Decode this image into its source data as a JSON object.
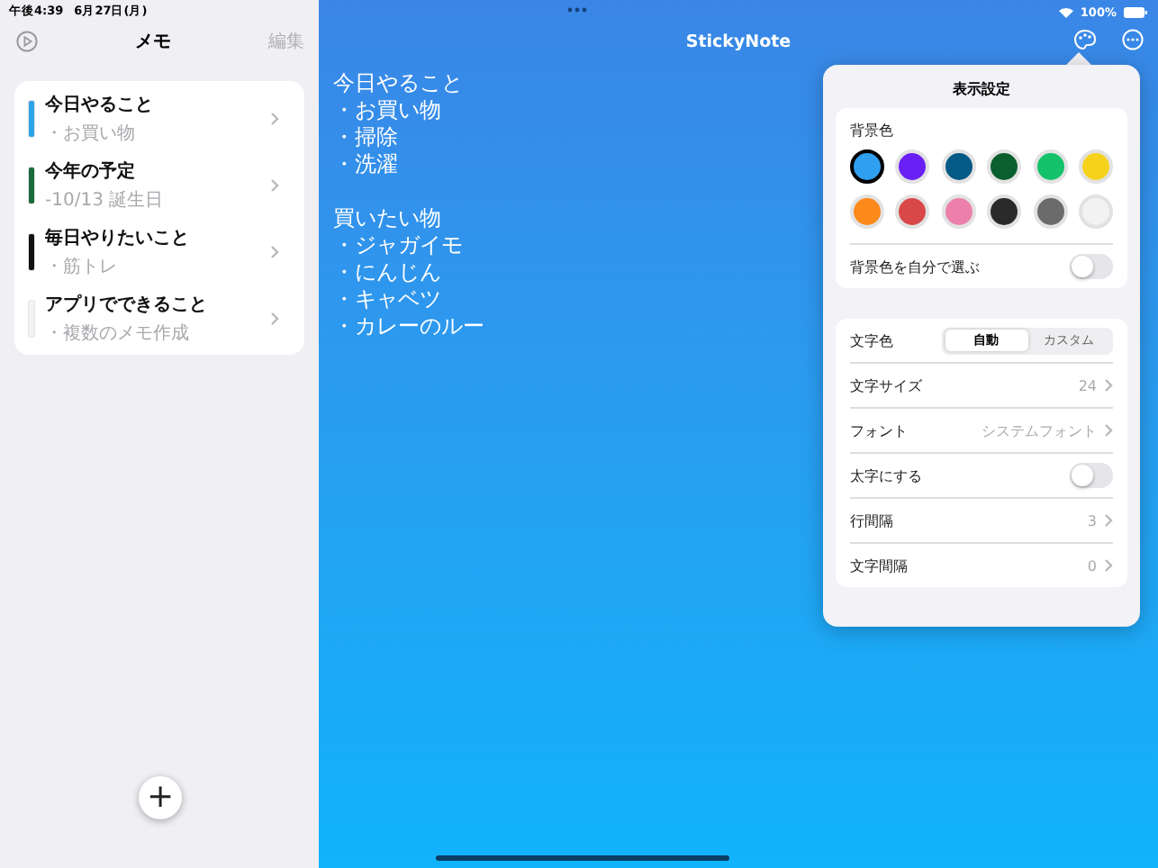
{
  "status_bar": {
    "time": "午後4:39",
    "date": "6月27日(月)",
    "battery": "100%"
  },
  "sidebar": {
    "title": "メモ",
    "edit": "編集",
    "memos": [
      {
        "title": "今日やること",
        "subtitle": "・お買い物",
        "color": "#2ea3e8"
      },
      {
        "title": "今年の予定",
        "subtitle": "-10/13 誕生日",
        "color": "#1a6b3c"
      },
      {
        "title": "毎日やりたいこと",
        "subtitle": "・筋トレ",
        "color": "#111111"
      },
      {
        "title": "アプリでできること",
        "subtitle": "・複数のメモ作成",
        "color": "#f2f2f2"
      }
    ],
    "add": "+"
  },
  "note": {
    "title": "StickyNote",
    "paragraphs": [
      {
        "lines": [
          "今日やること",
          "・お買い物",
          "・掃除",
          "・洗濯"
        ]
      },
      {
        "lines": [
          "買いたい物",
          "・ジャガイモ",
          "・にんじん",
          "・キャベツ",
          "・カレーのルー"
        ]
      }
    ]
  },
  "settings": {
    "title": "表示設定",
    "background_label": "背景色",
    "swatches": [
      {
        "color": "#2f9ff0",
        "selected": true
      },
      {
        "color": "#6a1ff5",
        "selected": false
      },
      {
        "color": "#045a86",
        "selected": false
      },
      {
        "color": "#0b5f2e",
        "selected": false
      },
      {
        "color": "#13c26a",
        "selected": false
      },
      {
        "color": "#f7d21d",
        "selected": false
      },
      {
        "color": "#fb8a1a",
        "selected": false
      },
      {
        "color": "#d94848",
        "selected": false
      },
      {
        "color": "#ec80aa",
        "selected": false
      },
      {
        "color": "#2a2a2a",
        "selected": false
      },
      {
        "color": "#6b6b6b",
        "selected": false
      },
      {
        "color": "#f2f2f2",
        "selected": false
      }
    ],
    "custom_background": {
      "label": "背景色を自分で選ぶ",
      "on": false
    },
    "rows": [
      {
        "kind": "segment",
        "label": "文字色",
        "options": [
          {
            "label": "自動",
            "selected": true
          },
          {
            "label": "カスタム",
            "selected": false
          }
        ]
      },
      {
        "kind": "value",
        "label": "文字サイズ",
        "value": "24"
      },
      {
        "kind": "value",
        "label": "フォント",
        "value": "システムフォント"
      },
      {
        "kind": "toggle",
        "label": "太字にする",
        "on": false
      },
      {
        "kind": "value",
        "label": "行間隔",
        "value": "3"
      },
      {
        "kind": "value",
        "label": "文字間隔",
        "value": "0"
      }
    ]
  }
}
